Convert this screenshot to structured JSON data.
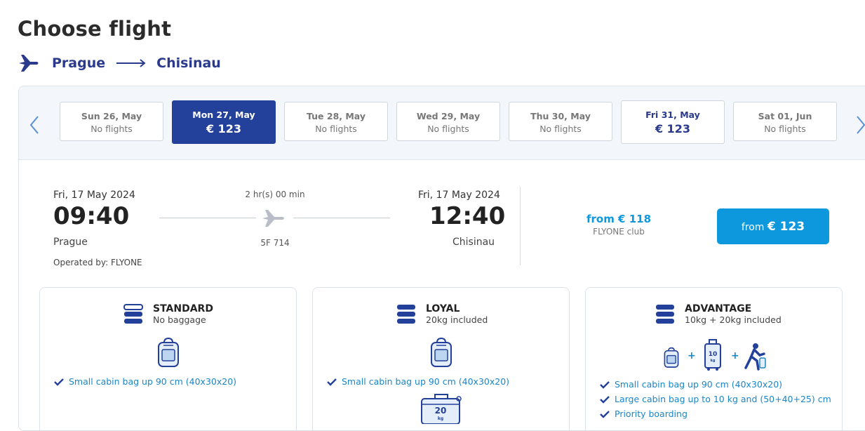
{
  "page": {
    "title": "Choose flight"
  },
  "route": {
    "origin": "Prague",
    "destination": "Chisinau"
  },
  "dates": [
    {
      "day": "Sun 26, May",
      "status": "No flights"
    },
    {
      "day": "Mon 27, May",
      "price": "€ 123",
      "selected": true
    },
    {
      "day": "Tue 28, May",
      "status": "No flights"
    },
    {
      "day": "Wed 29, May",
      "status": "No flights"
    },
    {
      "day": "Thu 30, May",
      "status": "No flights"
    },
    {
      "day": "Fri 31, May",
      "price": "€ 123"
    },
    {
      "day": "Sat 01, Jun",
      "status": "No flights"
    }
  ],
  "flight": {
    "departure": {
      "date": "Fri, 17 May 2024",
      "time": "09:40",
      "city": "Prague"
    },
    "arrival": {
      "date": "Fri, 17 May 2024",
      "time": "12:40",
      "city": "Chisinau"
    },
    "duration": "2 hr(s) 00 min",
    "flight_number": "5F 714",
    "operated_by_label": "Operated by:",
    "operator": "FLYONE",
    "club_price": "from € 118",
    "club_label": "FLYONE club",
    "button_prefix": "from",
    "button_price": "€ 123"
  },
  "fares": [
    {
      "name": "STANDARD",
      "subtitle": "No baggage",
      "features": [
        "Small cabin bag up 90 cm (40x30x20)"
      ]
    },
    {
      "name": "LOYAL",
      "subtitle": "20kg included",
      "features": [
        "Small cabin bag up 90 cm (40x30x20)"
      ],
      "bag_weight": "20",
      "bag_unit": "kg"
    },
    {
      "name": "ADVANTAGE",
      "subtitle": "10kg + 20kg included",
      "features": [
        "Small cabin bag up 90 cm (40x30x20)",
        "Large cabin bag up to 10 kg and (50+40+25) cm",
        "Priority boarding"
      ],
      "plus": "+",
      "bag_weight": "10",
      "bag_unit": "kg"
    }
  ],
  "colors": {
    "navy": "#23409a",
    "accent": "#0d97dc",
    "link": "#1a86c8"
  },
  "icons": [
    "plane-icon",
    "arrow-right-icon",
    "chevron-left-icon",
    "chevron-right-icon",
    "fare-stack-icon",
    "backpack-icon",
    "suitcase-icon",
    "trolley-icon",
    "priority-boarding-icon",
    "check-icon"
  ]
}
